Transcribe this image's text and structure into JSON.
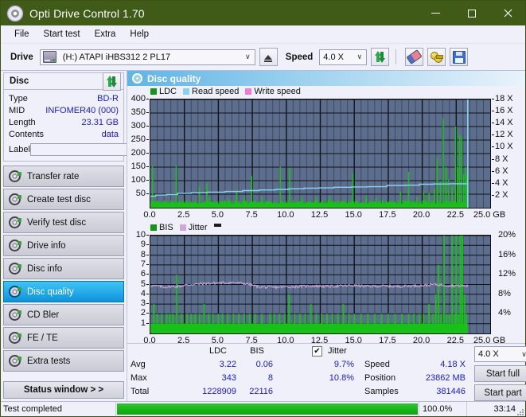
{
  "window": {
    "title": "Opti Drive Control 1.70",
    "icon": "disc-icon",
    "minimize": "–",
    "maximize": "□",
    "close": "✕"
  },
  "menu": {
    "items": [
      {
        "label": "File",
        "name": "menu-file"
      },
      {
        "label": "Start test",
        "name": "menu-start-test"
      },
      {
        "label": "Extra",
        "name": "menu-extra"
      },
      {
        "label": "Help",
        "name": "menu-help"
      }
    ]
  },
  "toolbar": {
    "drive_label": "Drive",
    "drive_value": "(H:)   ATAPI iHBS312   2 PL17",
    "eject_title": "Eject",
    "speed_label": "Speed",
    "speed_value": "4.0 X",
    "chevron": "∨",
    "buttons": [
      {
        "name": "refresh-button",
        "icon": "refresh-icon"
      },
      {
        "name": "erase-button",
        "icon": "eraser-icon"
      },
      {
        "name": "key-button",
        "icon": "key-icon"
      },
      {
        "name": "save-button",
        "icon": "save-icon"
      }
    ]
  },
  "disc_panel": {
    "title": "Disc",
    "refresh_icon": "refresh-icon",
    "rows": [
      {
        "key": "Type",
        "value": "BD-R"
      },
      {
        "key": "MID",
        "value": "INFOMER40 (000)"
      },
      {
        "key": "Length",
        "value": "23.31 GB"
      },
      {
        "key": "Contents",
        "value": "data"
      }
    ],
    "label_key": "Label",
    "label_value": "",
    "label_placeholder": "",
    "label_icon": "disc-icon"
  },
  "sidebar": {
    "items": [
      {
        "label": "Transfer rate",
        "name": "sidebar-item-transfer-rate",
        "active": false
      },
      {
        "label": "Create test disc",
        "name": "sidebar-item-create-test-disc",
        "active": false
      },
      {
        "label": "Verify test disc",
        "name": "sidebar-item-verify-test-disc",
        "active": false
      },
      {
        "label": "Drive info",
        "name": "sidebar-item-drive-info",
        "active": false
      },
      {
        "label": "Disc info",
        "name": "sidebar-item-disc-info",
        "active": false
      },
      {
        "label": "Disc quality",
        "name": "sidebar-item-disc-quality",
        "active": true
      },
      {
        "label": "CD Bler",
        "name": "sidebar-item-cd-bler",
        "active": false
      },
      {
        "label": "FE / TE",
        "name": "sidebar-item-fe-te",
        "active": false
      },
      {
        "label": "Extra tests",
        "name": "sidebar-item-extra-tests",
        "active": false
      }
    ],
    "status_window": "Status window > >"
  },
  "panel": {
    "title": "Disc quality",
    "icon": "disc-quality-icon"
  },
  "chart_data": [
    {
      "type": "line",
      "name": "ldc-chart",
      "title": "",
      "legend": [
        {
          "label": "LDC",
          "color": "#119911"
        },
        {
          "label": "Read speed",
          "color": "#86d2f0"
        },
        {
          "label": "Write speed",
          "color": "#f07cd8"
        }
      ],
      "legend_position": "top-left",
      "xlabel": "GB",
      "x": [
        0.0,
        2.5,
        5.0,
        7.5,
        10.0,
        12.5,
        15.0,
        17.5,
        20.0,
        22.5,
        25.0
      ],
      "xlim": [
        0.0,
        25.0
      ],
      "ylabel": "",
      "ylim": [
        0,
        400
      ],
      "yticks": [
        400,
        350,
        300,
        250,
        200,
        150,
        100,
        50
      ],
      "y2label": "X",
      "y2lim": [
        0,
        18
      ],
      "y2ticks": [
        "18 X",
        "16 X",
        "14 X",
        "12 X",
        "10 X",
        "8 X",
        "6 X",
        "4 X",
        "2 X"
      ],
      "grid": true,
      "plot_bg": "#5d6d8d",
      "data_end_gb": 23.35,
      "series": [
        {
          "name": "LDC",
          "color": "#18c118",
          "kind": "spikes",
          "baseline": 14,
          "noise": 14,
          "spikes": [
            [
              0.15,
              155
            ],
            [
              1.9,
              155
            ],
            [
              3.6,
              78
            ],
            [
              4.15,
              92
            ],
            [
              4.35,
              40
            ],
            [
              5.7,
              34
            ],
            [
              6.35,
              66
            ],
            [
              6.9,
              45
            ],
            [
              7.45,
              118
            ],
            [
              8.2,
              40
            ],
            [
              9.55,
              152
            ],
            [
              10.25,
              148
            ],
            [
              11.1,
              42
            ],
            [
              12.2,
              38
            ],
            [
              13.2,
              40
            ],
            [
              14.9,
              128
            ],
            [
              15.9,
              44
            ],
            [
              16.6,
              38
            ],
            [
              18.4,
              60
            ],
            [
              19.0,
              132
            ],
            [
              19.6,
              40
            ],
            [
              20.1,
              66
            ],
            [
              20.5,
              54
            ],
            [
              20.9,
              70
            ],
            [
              21.1,
              184
            ],
            [
              21.35,
              98
            ],
            [
              21.55,
              330
            ],
            [
              21.75,
              150
            ],
            [
              21.95,
              106
            ],
            [
              22.2,
              80
            ],
            [
              22.45,
              300
            ],
            [
              22.6,
              150
            ],
            [
              22.75,
              270
            ],
            [
              22.9,
              262
            ],
            [
              23.05,
              124
            ],
            [
              23.2,
              150
            ],
            [
              23.3,
              120
            ]
          ]
        },
        {
          "name": "Read speed",
          "color": "#86d2f0",
          "kind": "step-line",
          "points": [
            [
              0.0,
              1.9
            ],
            [
              0.4,
              2.1
            ],
            [
              1.2,
              2.2
            ],
            [
              2.0,
              2.4
            ],
            [
              3.0,
              2.5
            ],
            [
              4.2,
              2.6
            ],
            [
              5.5,
              2.7
            ],
            [
              6.8,
              2.85
            ],
            [
              8.0,
              2.95
            ],
            [
              9.2,
              3.05
            ],
            [
              10.2,
              3.15
            ],
            [
              11.3,
              3.25
            ],
            [
              12.4,
              3.3
            ],
            [
              13.5,
              3.4
            ],
            [
              14.8,
              3.45
            ],
            [
              16.0,
              3.5
            ],
            [
              17.4,
              3.7
            ],
            [
              18.8,
              3.75
            ],
            [
              19.8,
              3.9
            ],
            [
              20.8,
              3.95
            ],
            [
              22.0,
              3.98
            ],
            [
              23.3,
              4.05
            ]
          ],
          "vertical_marker_gb": 23.35
        }
      ]
    },
    {
      "type": "line",
      "name": "bis-chart",
      "title": "",
      "legend": [
        {
          "label": "BIS",
          "color": "#119911"
        },
        {
          "label": "Jitter",
          "color": "#cfa8d8"
        }
      ],
      "legend_position": "top-left",
      "xlabel": "GB",
      "x": [
        0.0,
        2.5,
        5.0,
        7.5,
        10.0,
        12.5,
        15.0,
        17.5,
        20.0,
        22.5,
        25.0
      ],
      "xlim": [
        0.0,
        25.0
      ],
      "ylabel": "",
      "ylim": [
        0,
        10
      ],
      "yticks": [
        10,
        9,
        8,
        7,
        6,
        5,
        4,
        3,
        2,
        1
      ],
      "y2label": "%",
      "y2lim": [
        0,
        20
      ],
      "y2ticks": [
        "20%",
        "16%",
        "12%",
        "8%",
        "4%"
      ],
      "grid": true,
      "plot_bg": "#5d6d8d",
      "data_end_gb": 23.35,
      "series": [
        {
          "name": "BIS",
          "color": "#18c118",
          "kind": "spikes",
          "baseline": 1.0,
          "noise": 0.0,
          "spikes": [
            [
              0.25,
              3
            ],
            [
              0.5,
              2
            ],
            [
              0.85,
              2
            ],
            [
              1.2,
              2
            ],
            [
              1.45,
              2
            ],
            [
              1.65,
              2
            ],
            [
              1.95,
              6
            ],
            [
              2.3,
              2
            ],
            [
              2.7,
              2
            ],
            [
              3.0,
              2
            ],
            [
              3.3,
              2
            ],
            [
              3.6,
              2
            ],
            [
              3.95,
              3
            ],
            [
              4.3,
              2
            ],
            [
              4.6,
              2
            ],
            [
              5.0,
              2
            ],
            [
              5.3,
              2
            ],
            [
              5.7,
              2
            ],
            [
              6.1,
              2
            ],
            [
              6.5,
              2
            ],
            [
              6.9,
              2
            ],
            [
              7.3,
              2
            ],
            [
              7.7,
              2
            ],
            [
              8.2,
              2
            ],
            [
              8.8,
              2
            ],
            [
              9.1,
              2
            ],
            [
              9.5,
              2
            ],
            [
              9.9,
              2
            ],
            [
              10.2,
              4
            ],
            [
              10.6,
              2
            ],
            [
              11.0,
              2
            ],
            [
              11.4,
              2
            ],
            [
              11.8,
              3
            ],
            [
              12.2,
              2
            ],
            [
              12.6,
              2
            ],
            [
              13.0,
              2
            ],
            [
              13.4,
              2
            ],
            [
              13.8,
              2
            ],
            [
              14.2,
              3
            ],
            [
              14.6,
              2
            ],
            [
              15.0,
              2
            ],
            [
              15.5,
              2
            ],
            [
              16.0,
              2
            ],
            [
              16.5,
              2
            ],
            [
              17.0,
              2
            ],
            [
              17.5,
              2
            ],
            [
              18.0,
              2
            ],
            [
              18.5,
              2
            ],
            [
              19.0,
              2
            ],
            [
              19.4,
              2
            ],
            [
              19.8,
              2
            ],
            [
              20.1,
              2
            ],
            [
              20.5,
              3
            ],
            [
              20.8,
              2
            ],
            [
              21.0,
              4
            ],
            [
              21.2,
              7
            ],
            [
              21.4,
              2
            ],
            [
              21.6,
              12
            ],
            [
              21.8,
              2
            ],
            [
              22.0,
              2
            ],
            [
              22.2,
              11
            ],
            [
              22.4,
              2
            ],
            [
              22.5,
              16
            ],
            [
              22.65,
              2
            ],
            [
              22.8,
              11
            ],
            [
              22.95,
              12
            ],
            [
              23.1,
              4
            ],
            [
              23.25,
              2
            ]
          ]
        },
        {
          "name": "Jitter",
          "color": "#cfa8d8",
          "kind": "noisy-line",
          "avg_percent": 9.7,
          "points": [
            [
              0.0,
              9.8
            ],
            [
              1.0,
              9.5
            ],
            [
              2.0,
              9.6
            ],
            [
              3.0,
              10.0
            ],
            [
              4.0,
              10.2
            ],
            [
              5.0,
              10.3
            ],
            [
              6.0,
              10.4
            ],
            [
              7.0,
              10.2
            ],
            [
              8.0,
              9.5
            ],
            [
              9.0,
              9.4
            ],
            [
              10.0,
              9.5
            ],
            [
              11.0,
              9.6
            ],
            [
              12.0,
              9.7
            ],
            [
              13.0,
              9.6
            ],
            [
              14.0,
              9.7
            ],
            [
              15.0,
              9.8
            ],
            [
              16.0,
              9.6
            ],
            [
              17.0,
              9.7
            ],
            [
              18.0,
              9.6
            ],
            [
              19.0,
              9.7
            ],
            [
              20.0,
              9.8
            ],
            [
              21.0,
              10.0
            ],
            [
              22.0,
              9.8
            ],
            [
              23.3,
              9.7
            ]
          ]
        }
      ]
    }
  ],
  "stats": {
    "col_headers": [
      "LDC",
      "BIS"
    ],
    "row_labels": [
      "Avg",
      "Max",
      "Total"
    ],
    "ldc": {
      "avg": "3.22",
      "max": "343",
      "total": "1228909"
    },
    "bis": {
      "avg": "0.06",
      "max": "8",
      "total": "22116"
    },
    "jitter": {
      "label": "Jitter",
      "checked": true,
      "check_glyph": "✔",
      "avg": "9.7%",
      "max": "10.8%"
    },
    "speed_label": "Speed",
    "speed_value": "4.18 X",
    "position_label": "Position",
    "position_value": "23862 MB",
    "samples_label": "Samples",
    "samples_value": "381446",
    "speed_select": "4.0 X",
    "speed_select_chevron": "∨",
    "start_full": "Start full",
    "start_part": "Start part"
  },
  "statusbar": {
    "message": "Test completed",
    "progress_percent": "100.0%",
    "progress_value": 100,
    "elapsed": "33:14"
  },
  "colors": {
    "titlebar": "#3f5b17",
    "accent": "#0d93dd",
    "plot_bg": "#5d6d8d",
    "green": "#18c118",
    "value_text": "#1b1bcf",
    "progress": "#0aa60a"
  }
}
